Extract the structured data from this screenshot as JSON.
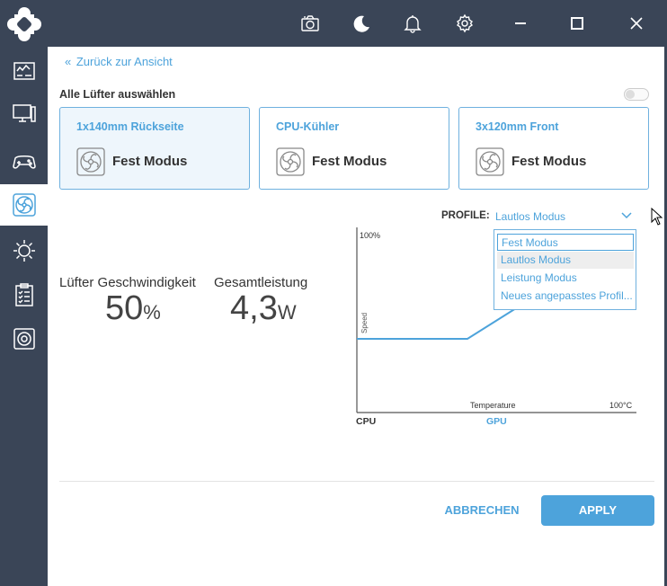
{
  "colors": {
    "accent": "#4da3db",
    "sidebar": "#3a4557",
    "card_selected_bg": "#eef6fc"
  },
  "topbar": {
    "icons": [
      "camera-icon",
      "moon-icon",
      "bell-icon",
      "gear-icon",
      "minimize-icon",
      "maximize-icon",
      "close-icon"
    ]
  },
  "sidebar": {
    "items": [
      {
        "icon": "dashboard-icon",
        "active": false
      },
      {
        "icon": "monitor-icon",
        "active": false
      },
      {
        "icon": "gamepad-icon",
        "active": false
      },
      {
        "icon": "fan-icon",
        "active": true
      },
      {
        "icon": "lighting-icon",
        "active": false
      },
      {
        "icon": "clipboard-icon",
        "active": false
      },
      {
        "icon": "speaker-icon",
        "active": false
      }
    ]
  },
  "back_link": {
    "label": "Zurück zur Ansicht"
  },
  "select_all": {
    "label": "Alle Lüfter auswählen",
    "enabled": false
  },
  "fans": [
    {
      "title": "1x140mm Rückseite",
      "mode": "Fest Modus",
      "selected": true
    },
    {
      "title": "CPU-Kühler",
      "mode": "Fest Modus",
      "selected": false
    },
    {
      "title": "3x120mm Front",
      "mode": "Fest Modus",
      "selected": false
    }
  ],
  "profile": {
    "label": "PROFILE:",
    "value": "Lautlos Modus",
    "options": [
      "Fest Modus",
      "Lautlos Modus",
      "Leistung Modus",
      "Neues angepasstes Profil..."
    ]
  },
  "metrics": {
    "speed": {
      "label": "Lüfter Geschwindigkeit",
      "value": "50",
      "unit": "%"
    },
    "power": {
      "label": "Gesamtleistung",
      "value": "4,3",
      "unit": "W"
    }
  },
  "chart_data": {
    "type": "line",
    "ylabel": "Speed",
    "xlabel": "Temperature",
    "y_max_label": "100%",
    "x_max_label": "100°C",
    "tabs": [
      {
        "label": "CPU",
        "active": false
      },
      {
        "label": "GPU",
        "active": true
      }
    ]
  },
  "actions": {
    "cancel_label": "ABBRECHEN",
    "apply_label": "APPLY"
  }
}
